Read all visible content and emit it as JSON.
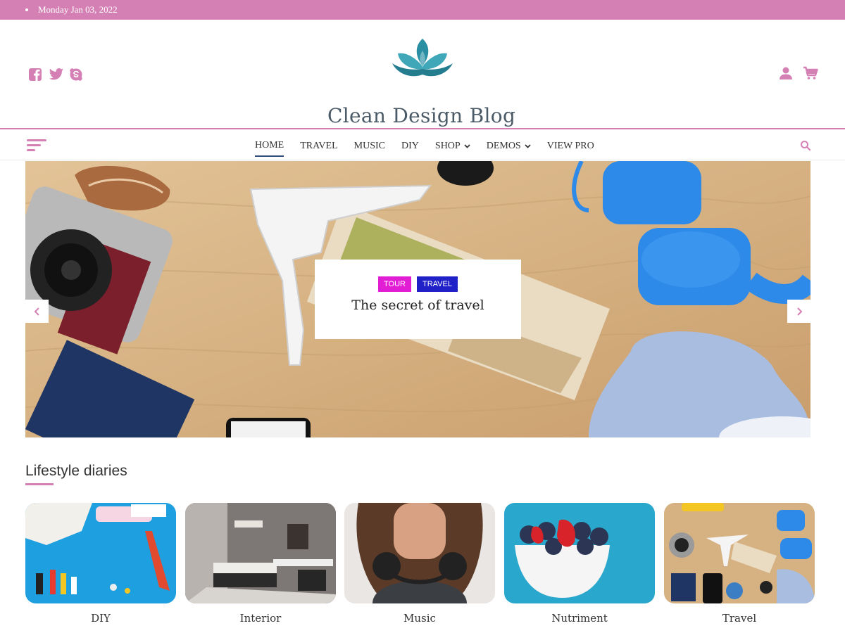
{
  "topbar": {
    "date": "Monday Jan 03, 2022"
  },
  "header": {
    "site_title": "Clean Design Blog",
    "social_icons": [
      "facebook-icon",
      "twitter-icon",
      "skype-icon"
    ],
    "right_icons": [
      "user-icon",
      "cart-icon"
    ]
  },
  "nav": {
    "items": [
      {
        "label": "HOME",
        "active": true
      },
      {
        "label": "TRAVEL"
      },
      {
        "label": "MUSIC"
      },
      {
        "label": "DIY"
      },
      {
        "label": "SHOP",
        "has_dropdown": true
      },
      {
        "label": "DEMOS",
        "has_dropdown": true
      },
      {
        "label": "VIEW PRO"
      }
    ]
  },
  "slider": {
    "tags": [
      "TOUR",
      "TRAVEL"
    ],
    "title": "The secret of travel"
  },
  "section": {
    "title": "Lifestyle diaries",
    "categories": [
      "DIY",
      "Interior",
      "Music",
      "Nutriment",
      "Travel"
    ]
  },
  "colors": {
    "accent": "#d580b5",
    "tag_tour": "#e21ed4",
    "tag_travel": "#2121c8",
    "logo_teal": "#2a8fa3"
  }
}
